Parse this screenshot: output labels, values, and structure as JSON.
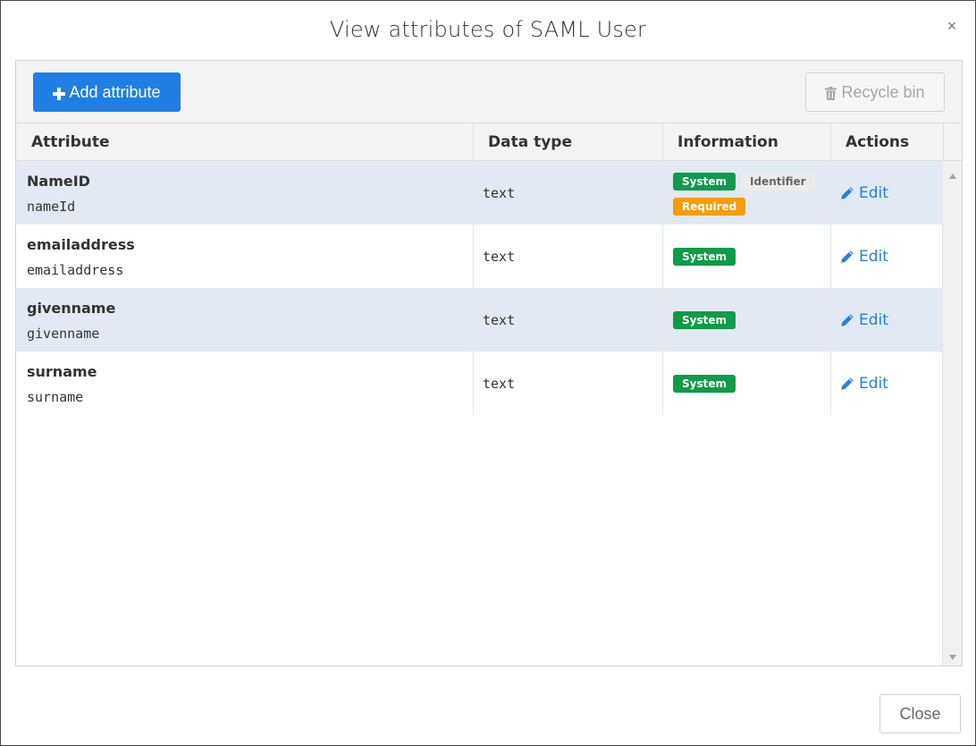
{
  "dialog": {
    "title": "View attributes of SAML User",
    "close_glyph": "×"
  },
  "toolbar": {
    "add_label": "Add attribute",
    "add_icon": "plus-icon",
    "recycle_label": "Recycle bin",
    "recycle_icon": "trash-icon"
  },
  "table": {
    "headers": [
      "Attribute",
      "Data type",
      "Information",
      "Actions"
    ],
    "rows": [
      {
        "name": "NameID",
        "key": "nameId",
        "type": "text",
        "badges": [
          "System",
          "Identifier",
          "Required"
        ],
        "action": "Edit"
      },
      {
        "name": "emailaddress",
        "key": "emailaddress",
        "type": "text",
        "badges": [
          "System"
        ],
        "action": "Edit"
      },
      {
        "name": "givenname",
        "key": "givenname",
        "type": "text",
        "badges": [
          "System"
        ],
        "action": "Edit"
      },
      {
        "name": "surname",
        "key": "surname",
        "type": "text",
        "badges": [
          "System"
        ],
        "action": "Edit"
      }
    ]
  },
  "footer": {
    "close_label": "Close"
  },
  "colors": {
    "primary": "#1f7fe5",
    "system_badge": "#0f9b4a",
    "required_badge": "#f59c0b",
    "identifier_badge": "#ececec",
    "link": "#2a7ee0",
    "stripe": "#e2e9f2"
  }
}
